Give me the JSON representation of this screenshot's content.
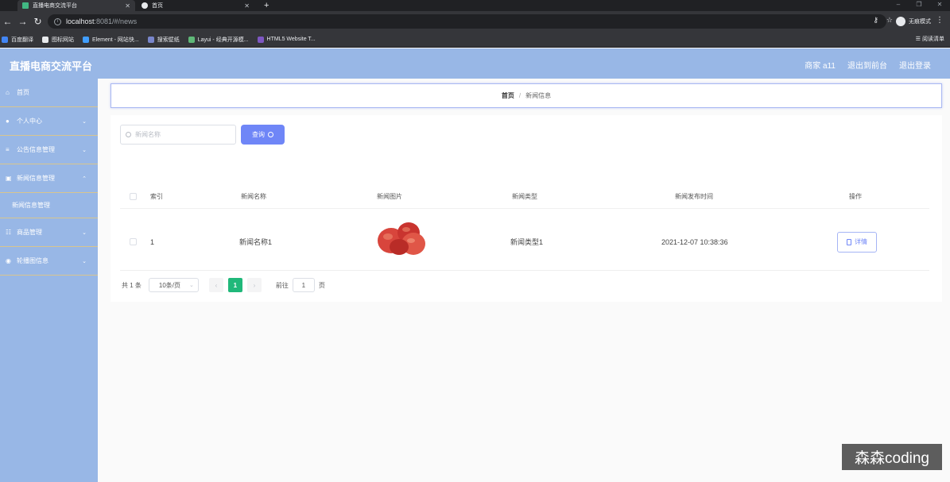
{
  "browser": {
    "tabs": [
      {
        "title": "直播电商交流平台",
        "active": true
      },
      {
        "title": "首页",
        "active": false
      }
    ],
    "url_host": "localhost",
    "url_path": ":8081/#/news",
    "incognito_label": "无痕模式",
    "bookmarks": [
      "百度翻译",
      "图标网站",
      "Element - 网站快...",
      "搜索壁纸",
      "Layui - 经典开源模...",
      "HTML5 Website T..."
    ],
    "reading_list": "阅读清单"
  },
  "header": {
    "title": "直播电商交流平台",
    "user": "商家 a11",
    "back_to_admin": "退出到前台",
    "logout": "退出登录"
  },
  "sidebar": {
    "items": [
      {
        "label": "首页",
        "icon": "home-icon"
      },
      {
        "label": "个人中心",
        "icon": "user-icon"
      },
      {
        "label": "公告信息管理",
        "icon": "list-icon"
      },
      {
        "label": "新闻信息管理",
        "icon": "news-icon"
      },
      {
        "label": "新闻信息管理",
        "icon": ""
      },
      {
        "label": "商品管理",
        "icon": "goods-icon"
      },
      {
        "label": "轮播图信息",
        "icon": "location-icon"
      }
    ]
  },
  "breadcrumb": {
    "home": "首页",
    "current": "新闻信息"
  },
  "search": {
    "placeholder": "新闻名称",
    "button": "查询"
  },
  "table": {
    "headers": [
      "索引",
      "新闻名称",
      "新闻图片",
      "新闻类型",
      "新闻发布时间",
      "操作"
    ],
    "rows": [
      {
        "index": "1",
        "name": "新闻名称1",
        "type": "新闻类型1",
        "time": "2021-12-07 10:38:36",
        "action": "详情"
      }
    ]
  },
  "pagination": {
    "total": "共 1 条",
    "page_size": "10条/页",
    "current_page": "1",
    "goto_label": "前往",
    "goto_value": "1",
    "page_suffix": "页"
  },
  "watermark": "森森coding"
}
